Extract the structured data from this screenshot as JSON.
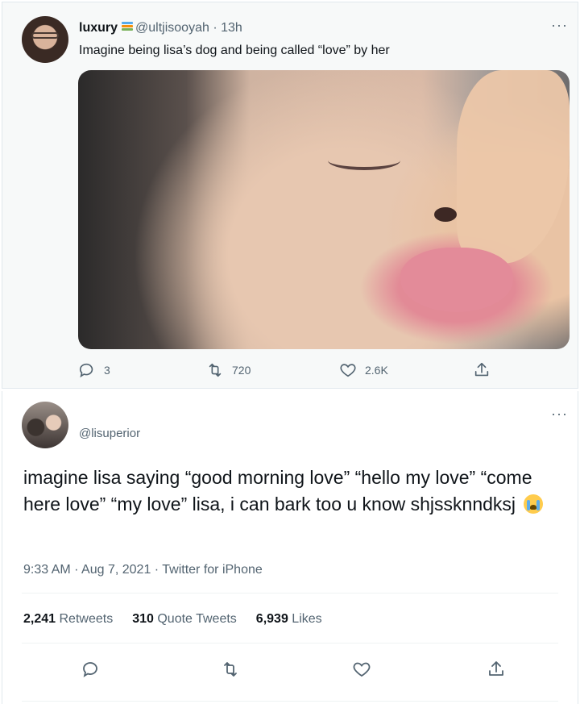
{
  "tweet1": {
    "display_name": "luxury",
    "handle": "@ultjisooyah",
    "separator": "·",
    "time": "13h",
    "more": "···",
    "text": "Imagine being lisa’s dog and being called “love” by her",
    "actions": {
      "replies": "3",
      "retweets": "720",
      "likes": "2.6K"
    }
  },
  "tweet2": {
    "handle": "@lisuperior",
    "more": "···",
    "text": "imagine lisa saying “good morning love” “hello my love” “come here love” “my love” lisa, i can bark too u know shjssknndksj",
    "meta": "9:33 AM · Aug 7, 2021 · Twitter for iPhone",
    "stats": {
      "retweets_count": "2,241",
      "retweets_label": "Retweets",
      "quotes_count": "310",
      "quotes_label": "Quote Tweets",
      "likes_count": "6,939",
      "likes_label": "Likes"
    }
  },
  "icons": {
    "reply": "reply-icon",
    "retweet": "retweet-icon",
    "like": "heart-icon",
    "share": "share-icon",
    "emoji": "loudly-crying-face-icon",
    "books": "books-emoji-icon"
  },
  "colors": {
    "muted": "#536471",
    "text": "#0f1419",
    "background_top": "#f7f9f9"
  }
}
